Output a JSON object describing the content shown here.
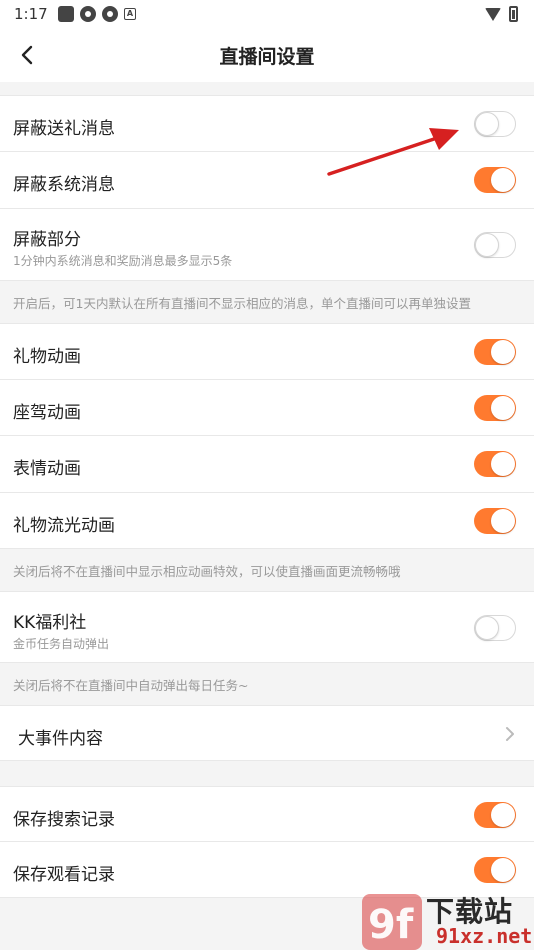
{
  "status_bar": {
    "time": "1:17",
    "notification_icon_letter": "A"
  },
  "header": {
    "title": "直播间设置",
    "back_icon": "chevron-left-icon"
  },
  "groups": [
    {
      "rows": [
        {
          "label": "屏蔽送礼消息",
          "toggle": "off"
        },
        {
          "label": "屏蔽系统消息",
          "toggle": "on"
        },
        {
          "label": "屏蔽部分",
          "subtitle": "1分钟内系统消息和奖励消息最多显示5条",
          "toggle": "off"
        }
      ],
      "hint": "开启后，可1天内默认在所有直播间不显示相应的消息，单个直播间可以再单独设置"
    },
    {
      "rows": [
        {
          "label": "礼物动画",
          "toggle": "on"
        },
        {
          "label": "座驾动画",
          "toggle": "on"
        },
        {
          "label": "表情动画",
          "toggle": "on"
        },
        {
          "label": "礼物流光动画",
          "toggle": "on"
        }
      ],
      "hint": "关闭后将不在直播间中显示相应动画特效，可以使直播画面更流畅畅哦"
    },
    {
      "rows": [
        {
          "label": "KK福利社",
          "subtitle": "金币任务自动弹出",
          "toggle": "off"
        }
      ],
      "hint": "关闭后将不在直播间中自动弹出每日任务~"
    },
    {
      "rows": [
        {
          "label": "大事件内容",
          "type": "link"
        }
      ]
    },
    {
      "rows": [
        {
          "label": "保存搜索记录",
          "toggle": "on"
        },
        {
          "label": "保存观看记录",
          "toggle": "on"
        }
      ]
    }
  ],
  "colors": {
    "accent": "#ff7a2f",
    "annotation_arrow": "#d62020"
  },
  "watermark": {
    "logo": "9f",
    "name": "下载站",
    "url": "91xz.net"
  }
}
